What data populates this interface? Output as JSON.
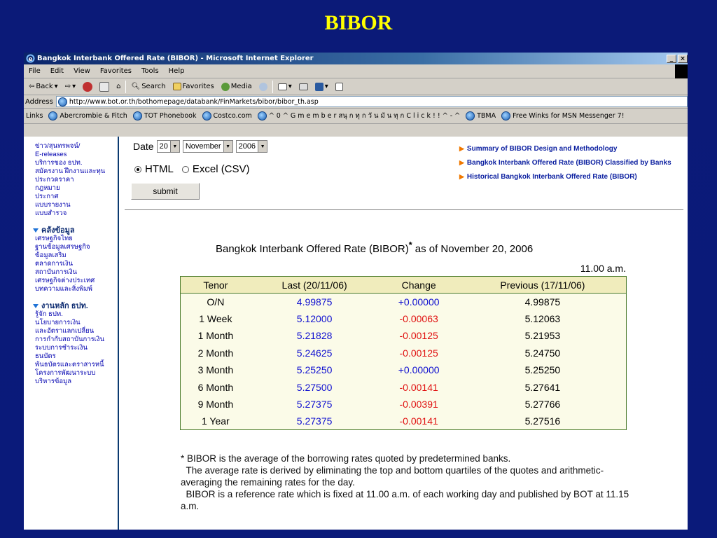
{
  "slide_title": "BIBOR",
  "window": {
    "title": "Bangkok Interbank Offered Rate (BIBOR) - Microsoft Internet Explorer",
    "controls": [
      "_",
      "×"
    ]
  },
  "menu": [
    "File",
    "Edit",
    "View",
    "Favorites",
    "Tools",
    "Help"
  ],
  "toolbar": {
    "back": "Back",
    "search": "Search",
    "favorites": "Favorites",
    "media": "Media"
  },
  "address": {
    "label": "Address",
    "url": "http://www.bot.or.th/bothomepage/databank/FinMarkets/bibor/bibor_th.asp"
  },
  "links": {
    "label": "Links",
    "items": [
      "Abercrombie & Fitch",
      "TOT Phonebook",
      "Costco.com",
      "^ 0 ^ G m e m b e r  สนุ ก ทุ ก วั น มั น ทุ ก C l i c k ! ! ^ - ^",
      "TBMA",
      "Free Winks for MSN Messenger 7!"
    ]
  },
  "sidebar": {
    "group1": [
      "ข่าว/สุนทรพจน์/",
      "E-releases",
      "บริการของ ธปท.",
      "สมัครงาน ฝึกงานและทุน",
      "ประกวดราคา",
      "กฎหมาย",
      "ประกาศ",
      "แบบรายงาน",
      "แบบสำรวจ"
    ],
    "section2": "คลังข้อมูล",
    "group2": [
      "เศรษฐกิจไทย",
      "ฐานข้อมูลเศรษฐกิจ",
      "ข้อมูลเสริม",
      "ตลาดการเงิน",
      "สถาบันการเงิน",
      "เศรษฐกิจต่างประเทศ",
      "บทความและสิ่งพิมพ์"
    ],
    "section3": "งานหลัก ธปท.",
    "group3": [
      "รู้จัก ธปท.",
      "นโยบายการเงิน",
      "และอัตราแลกเปลี่ยน",
      "การกำกับสถาบันการเงิน",
      "ระบบการชำระเงิน",
      "ธนบัตร",
      "พันธบัตรและตราสารหนี้",
      "โครงการพัฒนาระบบ",
      "บริหารข้อมูล"
    ]
  },
  "form": {
    "date_label": "Date",
    "day": "20",
    "month": "November",
    "year": "2006",
    "format_html": "HTML",
    "format_excel": "Excel (CSV)",
    "format_selected": "HTML",
    "submit": "submit"
  },
  "right_links": [
    "Summary of BIBOR Design and Methodology",
    "Bangkok Interbank Offered Rate (BIBOR) Classified by Banks",
    "Historical Bangkok Interbank Offered Rate (BIBOR)"
  ],
  "rates": {
    "heading": "Bangkok Interbank Offered Rate (BIBOR)",
    "heading_mark": "*",
    "heading_suffix": " as of November 20, 2006",
    "time": "11.00 a.m.",
    "headers": [
      "Tenor",
      "Last (20/11/06)",
      "Change",
      "Previous (17/11/06)"
    ],
    "rows": [
      [
        "O/N",
        "4.99875",
        "+0.00000",
        "4.99875"
      ],
      [
        "1 Week",
        "5.12000",
        "-0.00063",
        "5.12063"
      ],
      [
        "1 Month",
        "5.21828",
        "-0.00125",
        "5.21953"
      ],
      [
        "2 Month",
        "5.24625",
        "-0.00125",
        "5.24750"
      ],
      [
        "3 Month",
        "5.25250",
        "+0.00000",
        "5.25250"
      ],
      [
        "6 Month",
        "5.27500",
        "-0.00141",
        "5.27641"
      ],
      [
        "9 Month",
        "5.27375",
        "-0.00391",
        "5.27766"
      ],
      [
        "1 Year",
        "5.27375",
        "-0.00141",
        "5.27516"
      ]
    ]
  },
  "notes": [
    "* BIBOR is the average of the borrowing rates quoted by predetermined banks.",
    "  The average rate is derived by eliminating the top and bottom quartiles of the quotes and arithmetic-averaging the remaining rates for the day.",
    "  BIBOR is a reference rate which is fixed at 11.00 a.m. of each working day and published by BOT at 11.15 a.m."
  ]
}
